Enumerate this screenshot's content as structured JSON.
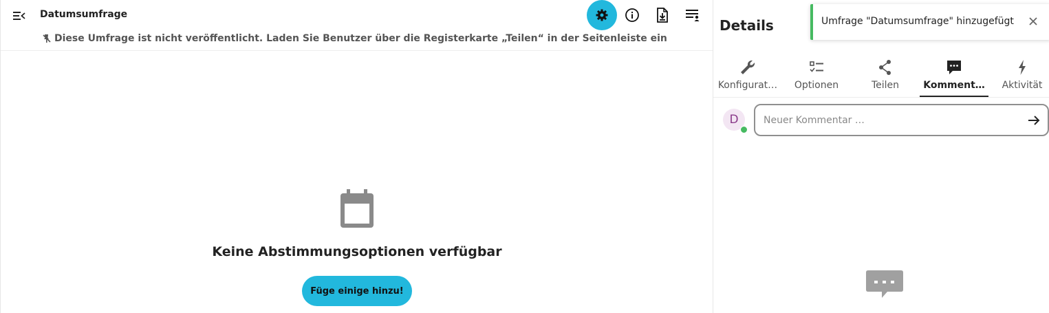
{
  "header": {
    "title": "Datumsumfrage",
    "unpublished_notice": "Diese Umfrage ist nicht veröffentlicht. Laden Sie Benutzer über die Registerkarte „Teilen“ in der Seitenleiste ein",
    "actions": [
      {
        "icon": "gear-icon",
        "active": true
      },
      {
        "icon": "info-icon",
        "active": false
      },
      {
        "icon": "export-icon",
        "active": false
      },
      {
        "icon": "options-list-icon",
        "active": false
      }
    ]
  },
  "empty_state": {
    "icon": "calendar-icon",
    "title": "Keine Abstimmungsoptionen verfügbar",
    "button_label": "Füge einige hinzu!"
  },
  "sidebar": {
    "title": "Details",
    "tabs": [
      {
        "label": "Konfigurat…",
        "icon": "wrench-icon",
        "active": false
      },
      {
        "label": "Optionen",
        "icon": "checklist-icon",
        "active": false
      },
      {
        "label": "Teilen",
        "icon": "share-icon",
        "active": false
      },
      {
        "label": "Komment…",
        "icon": "comment-icon",
        "active": true
      },
      {
        "label": "Aktivität",
        "icon": "lightning-icon",
        "active": false
      }
    ],
    "comment": {
      "avatar_initial": "D",
      "placeholder": "Neuer Kommentar …",
      "value": ""
    }
  },
  "toast": {
    "message": "Umfrage \"Datumsumfrage\" hinzugefügt"
  },
  "colors": {
    "accent": "#22b8dd",
    "success": "#46ba61",
    "avatar_bg": "#f3e6f3",
    "avatar_fg": "#8a3a8a"
  }
}
